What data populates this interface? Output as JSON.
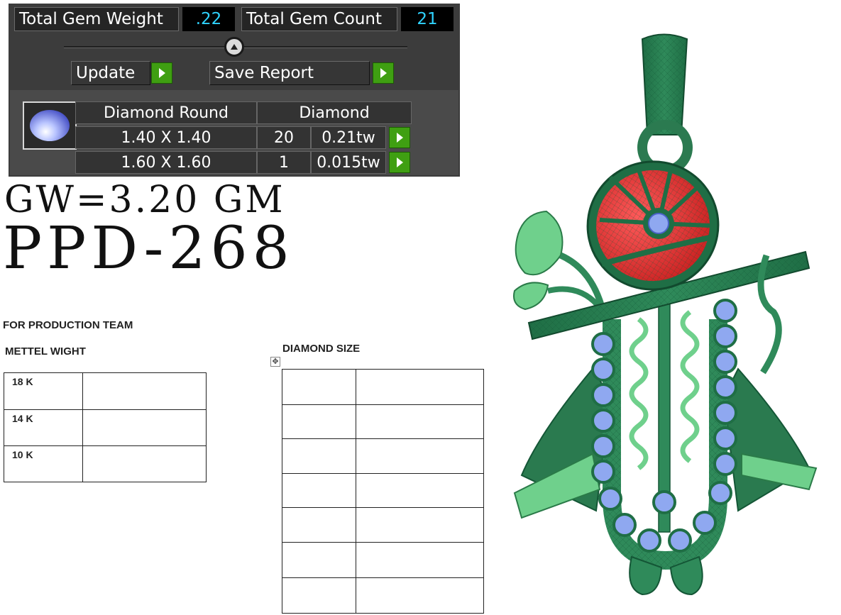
{
  "gem_panel": {
    "total_weight_label": "Total Gem Weight",
    "total_weight_value": ".22",
    "total_count_label": "Total Gem Count",
    "total_count_value": "21",
    "update_label": "Update",
    "save_report_label": "Save Report",
    "table": {
      "header_shape": "Diamond Round",
      "header_material": "Diamond",
      "rows": [
        {
          "size": "1.40 X 1.40",
          "count": "20",
          "weight": "0.21tw"
        },
        {
          "size": "1.60 X 1.60",
          "count": "1",
          "weight": "0.015tw"
        }
      ]
    },
    "colors": {
      "accent_value": "#2fd3ff",
      "go_button": "#3f9f12",
      "panel_bg": "#3c3c3c"
    }
  },
  "gross_weight_text": "GW=3.20 GM",
  "product_code": "PPD-268",
  "production": {
    "team_heading": "FOR PRODUCTION TEAM",
    "metal_heading": "METTEL WIGHT",
    "metal_rows": [
      {
        "karat": "18 K",
        "value": ""
      },
      {
        "karat": "14 K",
        "value": ""
      },
      {
        "karat": "10 K",
        "value": ""
      }
    ],
    "diamond_heading": "DIAMOND SIZE",
    "diamond_rows": [
      {
        "size": "",
        "value": ""
      },
      {
        "size": "",
        "value": ""
      },
      {
        "size": "",
        "value": ""
      },
      {
        "size": "",
        "value": ""
      },
      {
        "size": "",
        "value": ""
      },
      {
        "size": "",
        "value": ""
      },
      {
        "size": "",
        "value": ""
      }
    ]
  },
  "render": {
    "metal_color": "#2f8a5a",
    "highlight_color": "#6fd08c",
    "enamel_color": "#e23a3a",
    "stone_color": "#8fa8f0"
  }
}
